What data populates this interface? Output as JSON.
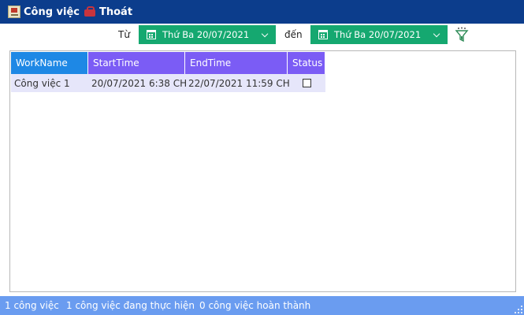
{
  "menu": {
    "work_label": "Công việc",
    "exit_label": "Thoát"
  },
  "filter": {
    "from_label": "Từ",
    "to_label": "đến",
    "from_date": "Thứ Ba 20/07/2021",
    "to_date": "Thứ Ba 20/07/2021"
  },
  "grid": {
    "columns": [
      "WorkName",
      "StartTime",
      "EndTime",
      "Status"
    ],
    "header_colors": [
      "#1e88e5",
      "#7b5cf5",
      "#7b5cf5",
      "#7b5cf5"
    ],
    "rows": [
      {
        "work_name": "Công việc 1",
        "start_time": "20/07/2021 6:38 CH",
        "end_time": "22/07/2021 11:59 CH",
        "status": false
      }
    ]
  },
  "status": {
    "total": "1 công việc",
    "in_progress": "1 công việc đang thực hiện",
    "done": "0 công việc hoàn thành"
  },
  "colors": {
    "menubar": "#0c3d8c",
    "datepicker": "#15a870",
    "row_bg": "#e6e6fa",
    "statusbar": "#6a9cf0"
  }
}
